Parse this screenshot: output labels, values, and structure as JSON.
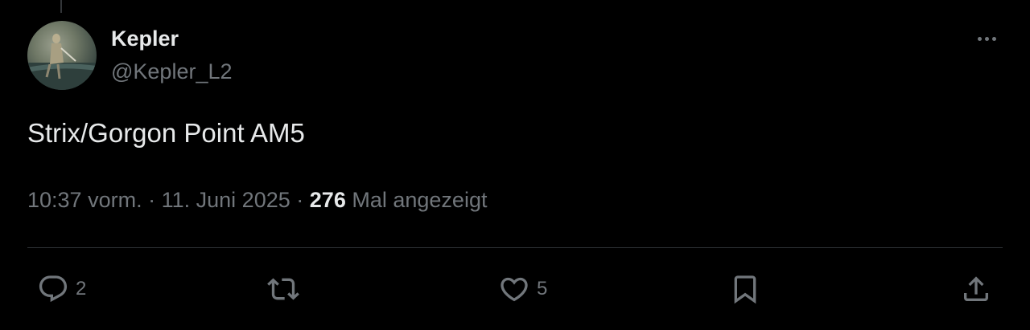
{
  "author": {
    "display_name": "Kepler",
    "handle": "@Kepler_L2"
  },
  "tweet": {
    "text": "Strix/Gorgon Point AM5",
    "time": "10:37 vorm.",
    "date": "11. Juni 2025",
    "separator": "·",
    "views_count": "276",
    "views_label": "Mal angezeigt"
  },
  "actions": {
    "reply_count": "2",
    "retweet_count": "",
    "like_count": "5"
  },
  "icons": {
    "more": "more-horizontal-icon",
    "reply": "reply-icon",
    "retweet": "retweet-icon",
    "like": "heart-icon",
    "bookmark": "bookmark-icon",
    "share": "share-icon"
  },
  "colors": {
    "background": "#000000",
    "text_primary": "#e7e9ea",
    "text_secondary": "#71767b",
    "divider": "#2f3336"
  }
}
